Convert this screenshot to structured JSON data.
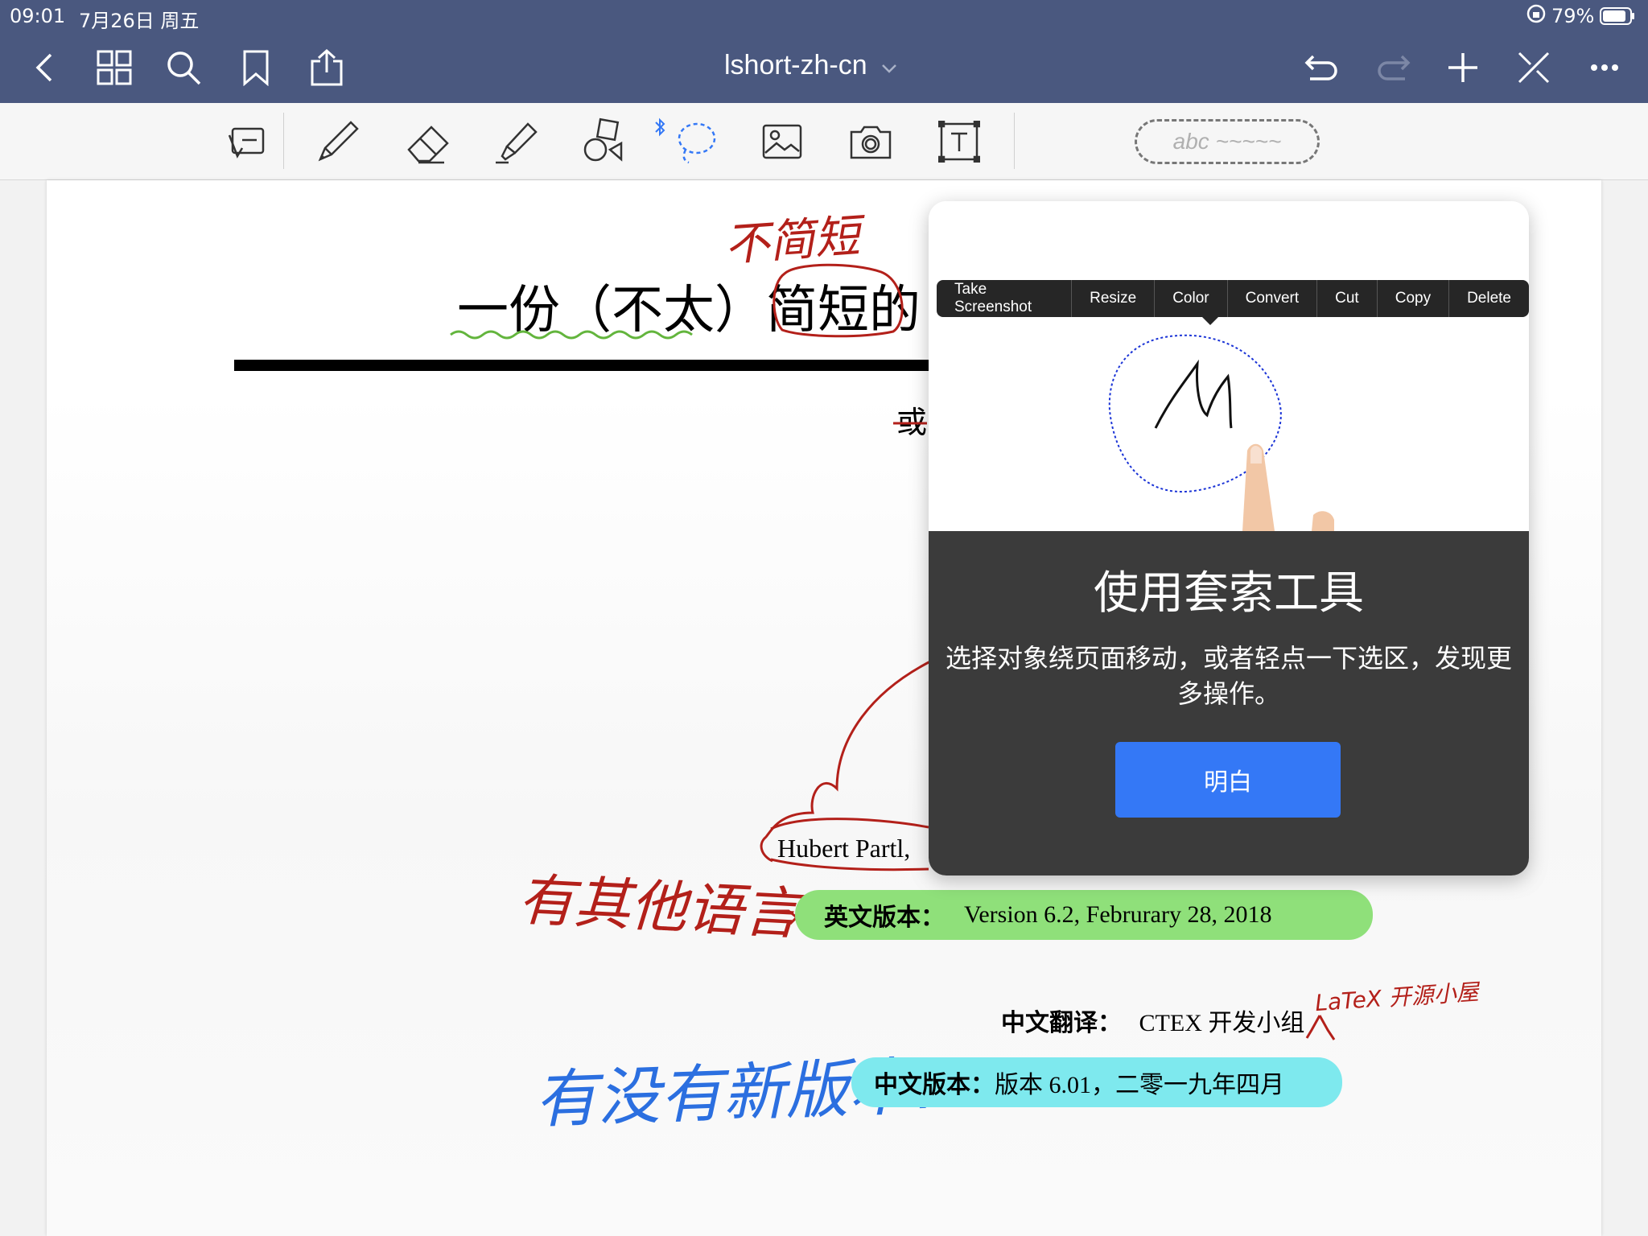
{
  "status": {
    "time": "09:01",
    "date": "7月26日 周五",
    "battery": "79%"
  },
  "header": {
    "title": "lshort-zh-cn",
    "title_icon": "chevron-down-icon"
  },
  "toolbar": {
    "handwriting_placeholder": "abc ~~~~~"
  },
  "document": {
    "title": "一份（不太）简短的",
    "partial_char": "或",
    "author": "Hubert Partl,",
    "english_label": "英文版本：",
    "english_value": "Version 6.2, Februrary 28, 2018",
    "translation_label": "中文翻译：",
    "translation_value": "CTEX 开发小组",
    "chinese_label": "中文版本：",
    "chinese_value": "版本 6.01，二零一九年四月"
  },
  "annotations": {
    "title_note": "不简短",
    "other_languages": "有其他语言?",
    "latex_note": "LaTeX 开源小屋",
    "new_version": "有没有新版本?"
  },
  "context_menu": [
    "Take Screenshot",
    "Resize",
    "Color",
    "Convert",
    "Cut",
    "Copy",
    "Delete"
  ],
  "popup": {
    "title": "使用套索工具",
    "description": "选择对象绕页面移动，或者轻点一下选区，发现更多操作。",
    "button": "明白"
  },
  "colors": {
    "nav": "#4a587f",
    "green_hl": "#8fe07a",
    "cyan_hl": "#7ee9ee",
    "button": "#3478f6",
    "red_ink": "#b3201a",
    "blue_ink": "#2b6fe0"
  }
}
